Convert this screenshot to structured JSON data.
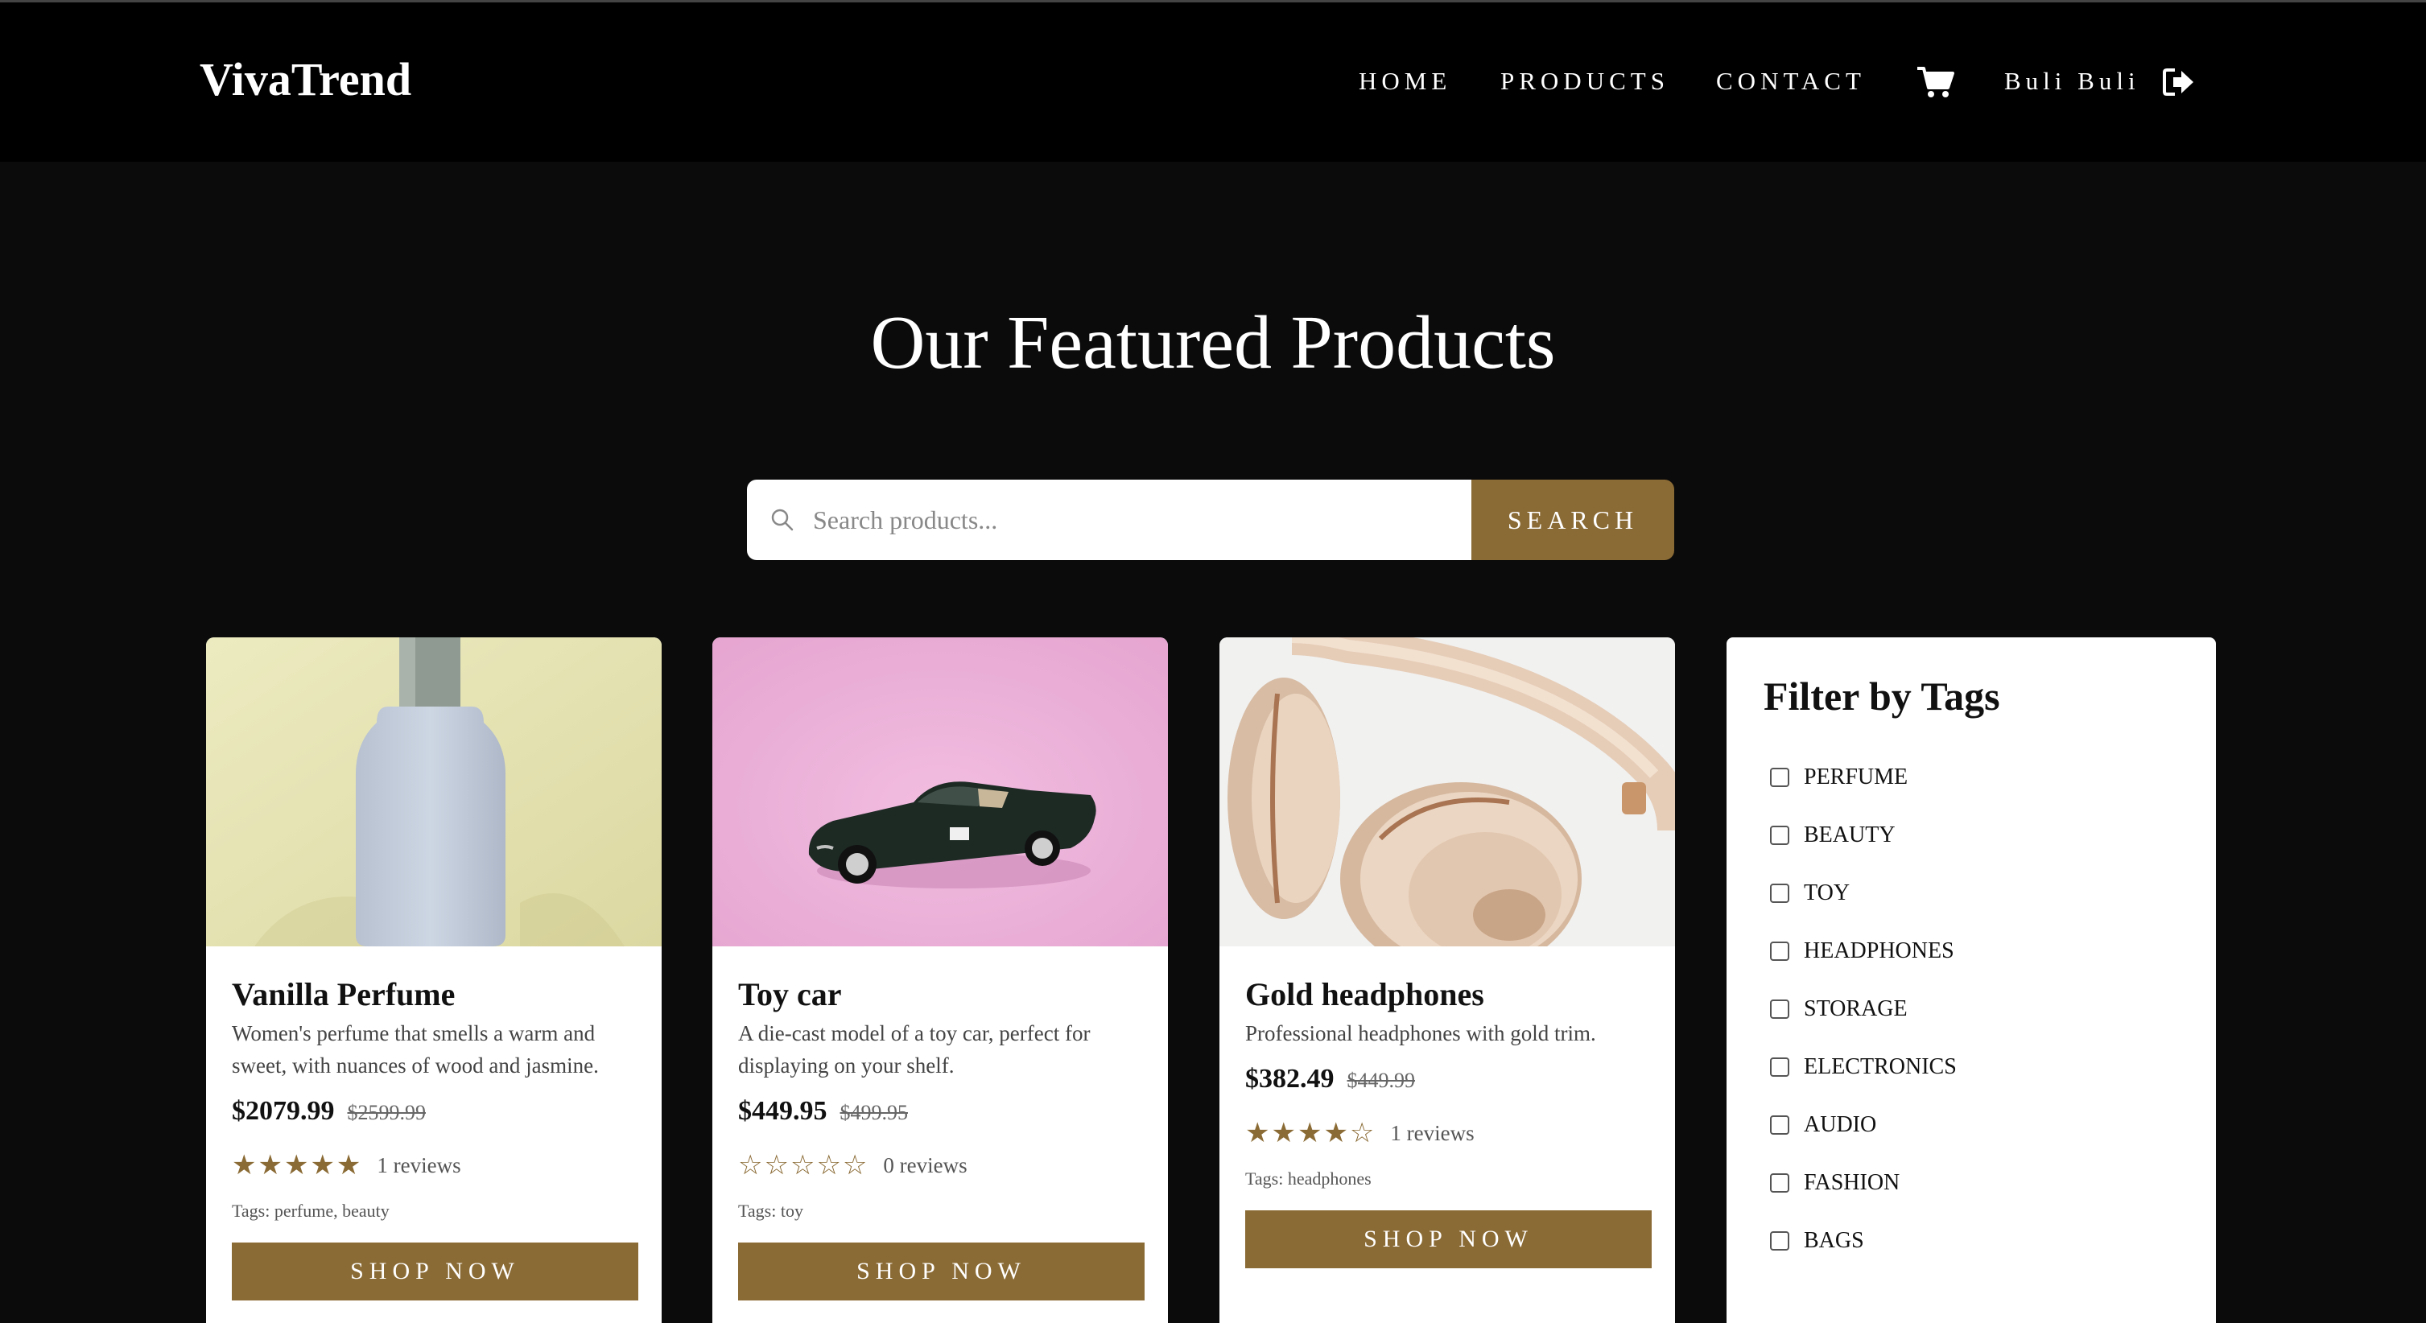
{
  "header": {
    "logo": "VivaTrend",
    "nav": [
      "HOME",
      "PRODUCTS",
      "CONTACT"
    ],
    "username": "Buli Buli"
  },
  "hero": {
    "title": "Our Featured Products"
  },
  "search": {
    "placeholder": "Search products...",
    "button_label": "SEARCH"
  },
  "products": [
    {
      "name": "Vanilla Perfume",
      "description": "Women's perfume that smells a warm and sweet, with nuances of wood and jasmine.",
      "price": "$2079.99",
      "old_price": "$2599.99",
      "stars": "★★★★★",
      "reviews": "1 reviews",
      "tags": "Tags: perfume, beauty",
      "button_label": "SHOP NOW"
    },
    {
      "name": "Toy car",
      "description": "A die-cast model of a toy car, perfect for displaying on your shelf.",
      "price": "$449.95",
      "old_price": "$499.95",
      "stars": "☆☆☆☆☆",
      "reviews": "0 reviews",
      "tags": "Tags: toy",
      "button_label": "SHOP NOW"
    },
    {
      "name": "Gold headphones",
      "description": "Professional headphones with gold trim.",
      "price": "$382.49",
      "old_price": "$449.99",
      "stars": "★★★★☆",
      "reviews": "1 reviews",
      "tags": "Tags: headphones",
      "button_label": "SHOP NOW"
    }
  ],
  "filter": {
    "title": "Filter by Tags",
    "tags": [
      "PERFUME",
      "BEAUTY",
      "TOY",
      "HEADPHONES",
      "STORAGE",
      "ELECTRONICS",
      "AUDIO",
      "FASHION",
      "BAGS"
    ]
  },
  "colors": {
    "accent": "#8b6b35",
    "background": "#0b0b0b",
    "header": "#000000"
  }
}
